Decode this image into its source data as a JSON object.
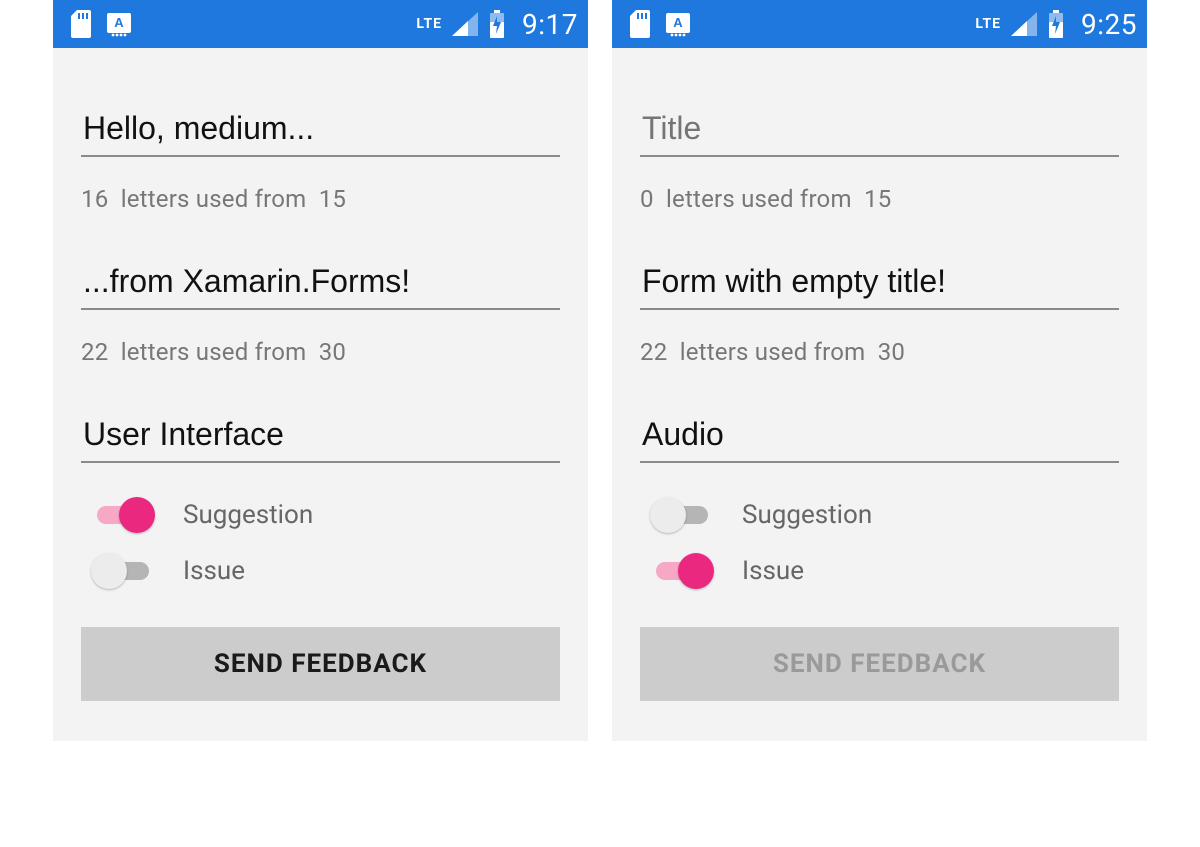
{
  "screens": [
    {
      "statusbar": {
        "network": "LTE",
        "time": "9:17"
      },
      "title": {
        "value": "Hello, medium...",
        "placeholder": "Title",
        "count": 16,
        "limit": 15
      },
      "body": {
        "value": "...from Xamarin.Forms!",
        "count": 22,
        "limit": 30
      },
      "category": {
        "value": "User Interface"
      },
      "switches": {
        "suggestion": {
          "label": "Suggestion",
          "on": true
        },
        "issue": {
          "label": "Issue",
          "on": false
        }
      },
      "send": {
        "label": "SEND FEEDBACK",
        "enabled": true
      },
      "counter_template": {
        "mid": "letters used from"
      }
    },
    {
      "statusbar": {
        "network": "LTE",
        "time": "9:25"
      },
      "title": {
        "value": "",
        "placeholder": "Title",
        "count": 0,
        "limit": 15
      },
      "body": {
        "value": "Form with empty title!",
        "count": 22,
        "limit": 30
      },
      "category": {
        "value": "Audio"
      },
      "switches": {
        "suggestion": {
          "label": "Suggestion",
          "on": false
        },
        "issue": {
          "label": "Issue",
          "on": true
        }
      },
      "send": {
        "label": "SEND FEEDBACK",
        "enabled": false
      },
      "counter_template": {
        "mid": "letters used from"
      }
    }
  ]
}
